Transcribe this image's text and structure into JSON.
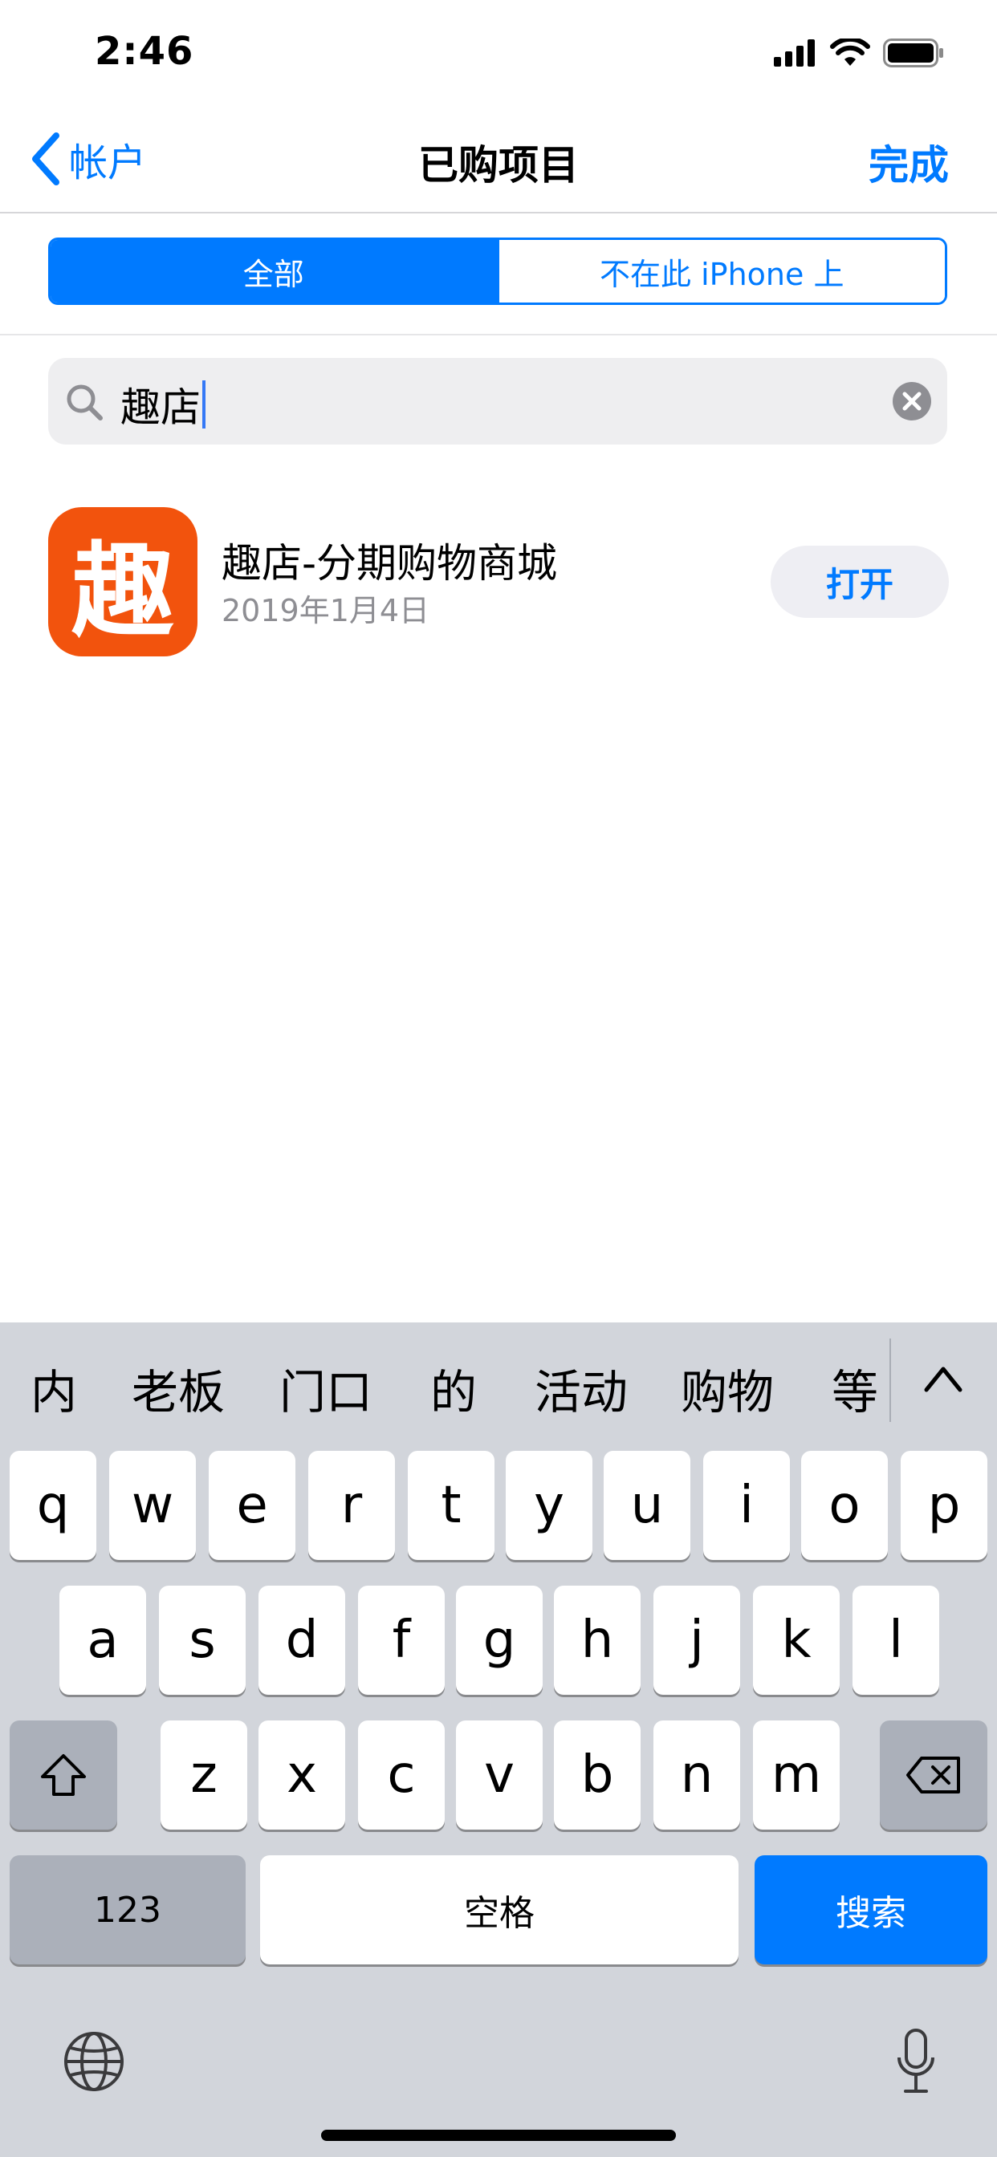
{
  "status_bar": {
    "time": "2:46"
  },
  "nav": {
    "back_label": "帐户",
    "title": "已购项目",
    "done_label": "完成"
  },
  "segments": {
    "all": "全部",
    "not_on_device": "不在此 iPhone 上",
    "selected": "全部"
  },
  "search": {
    "query": "趣店"
  },
  "results": [
    {
      "icon_char": "趣",
      "icon_color": "#f2530d",
      "name": "趣店-分期购物商城",
      "date": "2019年1月4日",
      "action": "打开"
    }
  ],
  "keyboard": {
    "candidates": [
      "内",
      "老板",
      "门口",
      "的",
      "活动",
      "购物",
      "等"
    ],
    "row1": [
      "q",
      "w",
      "e",
      "r",
      "t",
      "y",
      "u",
      "i",
      "o",
      "p"
    ],
    "row2": [
      "a",
      "s",
      "d",
      "f",
      "g",
      "h",
      "j",
      "k",
      "l"
    ],
    "row3": [
      "z",
      "x",
      "c",
      "v",
      "b",
      "n",
      "m"
    ],
    "numbers_label": "123",
    "space_label": "空格",
    "search_label": "搜索"
  },
  "colors": {
    "accent": "#007aff",
    "keyboard_bg": "#d2d5db",
    "app_icon": "#f2530d"
  }
}
